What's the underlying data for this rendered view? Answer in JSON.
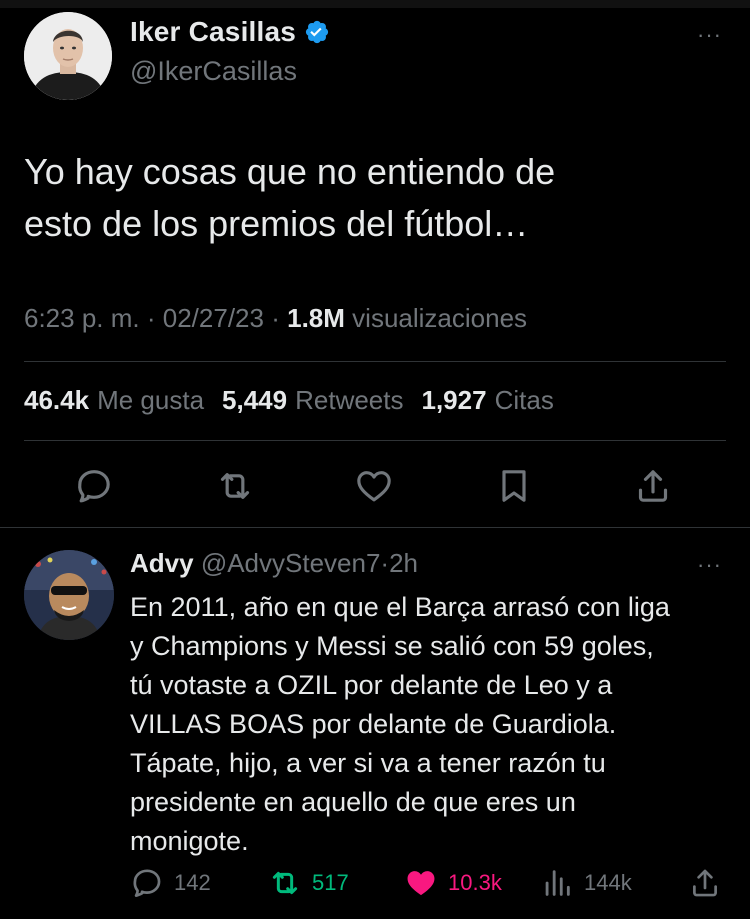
{
  "tweet": {
    "author_name": "Iker Casillas",
    "author_handle": "@IkerCasillas",
    "more_label": "···",
    "text": "Yo hay cosas que no entiendo de\nesto de los premios del fútbol…",
    "time": "6:23 p. m.",
    "sep": "·",
    "date": "02/27/23",
    "views_count": "1.8M",
    "views_label": "visualizaciones",
    "likes_count": "46.4k",
    "likes_label": "Me gusta",
    "retweets_count": "5,449",
    "retweets_label": "Retweets",
    "quotes_count": "1,927",
    "quotes_label": "Citas",
    "actions": [
      "reply-icon",
      "retweet-icon",
      "like-icon",
      "bookmark-icon",
      "share-icon"
    ]
  },
  "reply": {
    "author_name": "Advy",
    "author_handle": "@AdvySteven7",
    "sep": "·",
    "age": "2h",
    "more_label": "···",
    "text": "En 2011, año en que el Barça arrasó con liga\ny Champions y Messi se salió con 59 goles,\ntú votaste a OZIL por delante de Leo y a\nVILLAS BOAS por delante de Guardiola.\nTápate, hijo, a ver si va a tener razón tu\npresidente en aquello de que eres un\nmonigote.",
    "replies_count": "142",
    "retweets_count": "517",
    "likes_count": "10.3k",
    "views_count": "144k"
  },
  "colors": {
    "background": "#000000",
    "text": "#e7e9ea",
    "muted": "#71767b",
    "verified": "#1d9bf0",
    "retweet_active": "#00ba7c",
    "like_active": "#f91880",
    "divider": "#2f3336"
  }
}
